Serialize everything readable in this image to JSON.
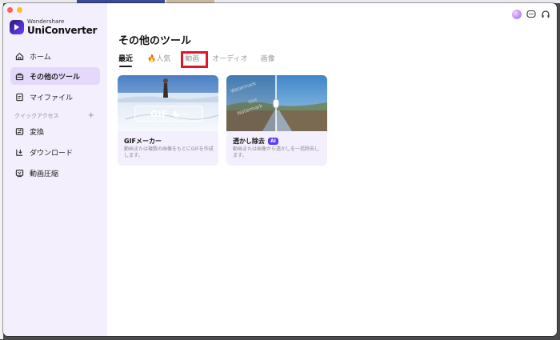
{
  "app": {
    "brand_sub": "Wondershare",
    "brand_name": "UniConverter"
  },
  "sidebar": {
    "items": [
      {
        "label": "ホーム",
        "icon": "home-icon"
      },
      {
        "label": "その他のツール",
        "icon": "toolbox-icon",
        "active": true
      },
      {
        "label": "マイファイル",
        "icon": "file-icon"
      }
    ],
    "section_label": "クイックアクセス",
    "section_action": "+",
    "quick_items": [
      {
        "label": "変換",
        "icon": "convert-icon"
      },
      {
        "label": "ダウンロード",
        "icon": "download-icon"
      },
      {
        "label": "動画圧縮",
        "icon": "compress-icon"
      }
    ]
  },
  "main": {
    "title": "その他のツール",
    "tabs": [
      {
        "label": "最近",
        "active": true
      },
      {
        "label": "🔥人気"
      },
      {
        "label": "動画"
      },
      {
        "label": "オーディオ"
      },
      {
        "label": "画像"
      }
    ],
    "cards": [
      {
        "title": "GIFメーカー",
        "badge": "",
        "description": "動画または複数の画像をもとにGIFを作成します。",
        "image_label": "GIF"
      },
      {
        "title": "透かし除去",
        "badge": "AI",
        "description": "動画または画像から透かしを一括除去します。",
        "image_label": "Watermark"
      }
    ]
  },
  "colors": {
    "accent": "#5b3cf5",
    "sidebar_bg": "#f3effc",
    "active_item_bg": "#e4d9fb",
    "highlight_box": "#e0142a"
  }
}
